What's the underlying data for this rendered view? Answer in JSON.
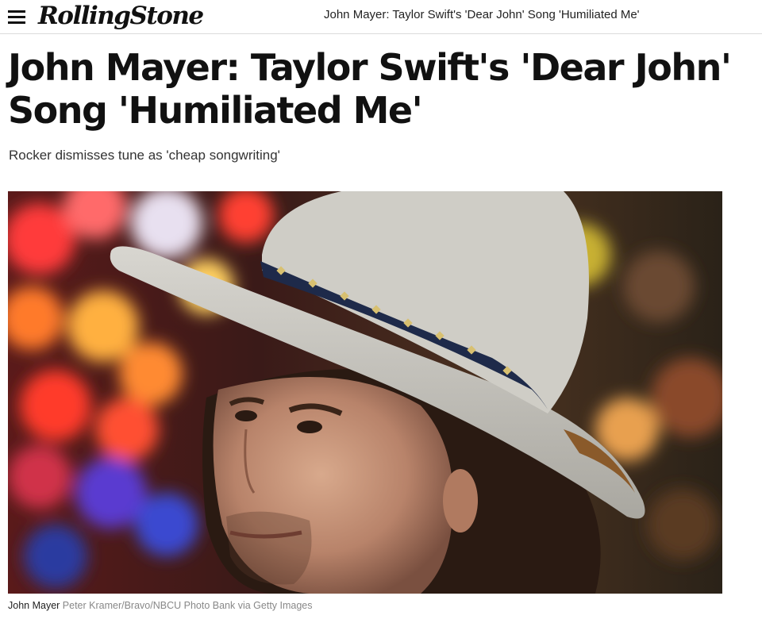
{
  "header": {
    "logo_text": "RollingStone",
    "menu_icon": "hamburger-menu-icon",
    "article_title": "John Mayer: Taylor Swift's 'Dear John' Song 'Humiliated Me'"
  },
  "article": {
    "headline": "John Mayer: Taylor Swift's 'Dear John' Song 'Humiliated Me'",
    "subheadline": "Rocker dismisses tune as 'cheap songwriting'",
    "image": {
      "alt": "John Mayer",
      "caption_name": "John Mayer",
      "caption_credit": "Peter Kramer/Bravo/NBCU Photo Bank via Getty Images"
    }
  }
}
